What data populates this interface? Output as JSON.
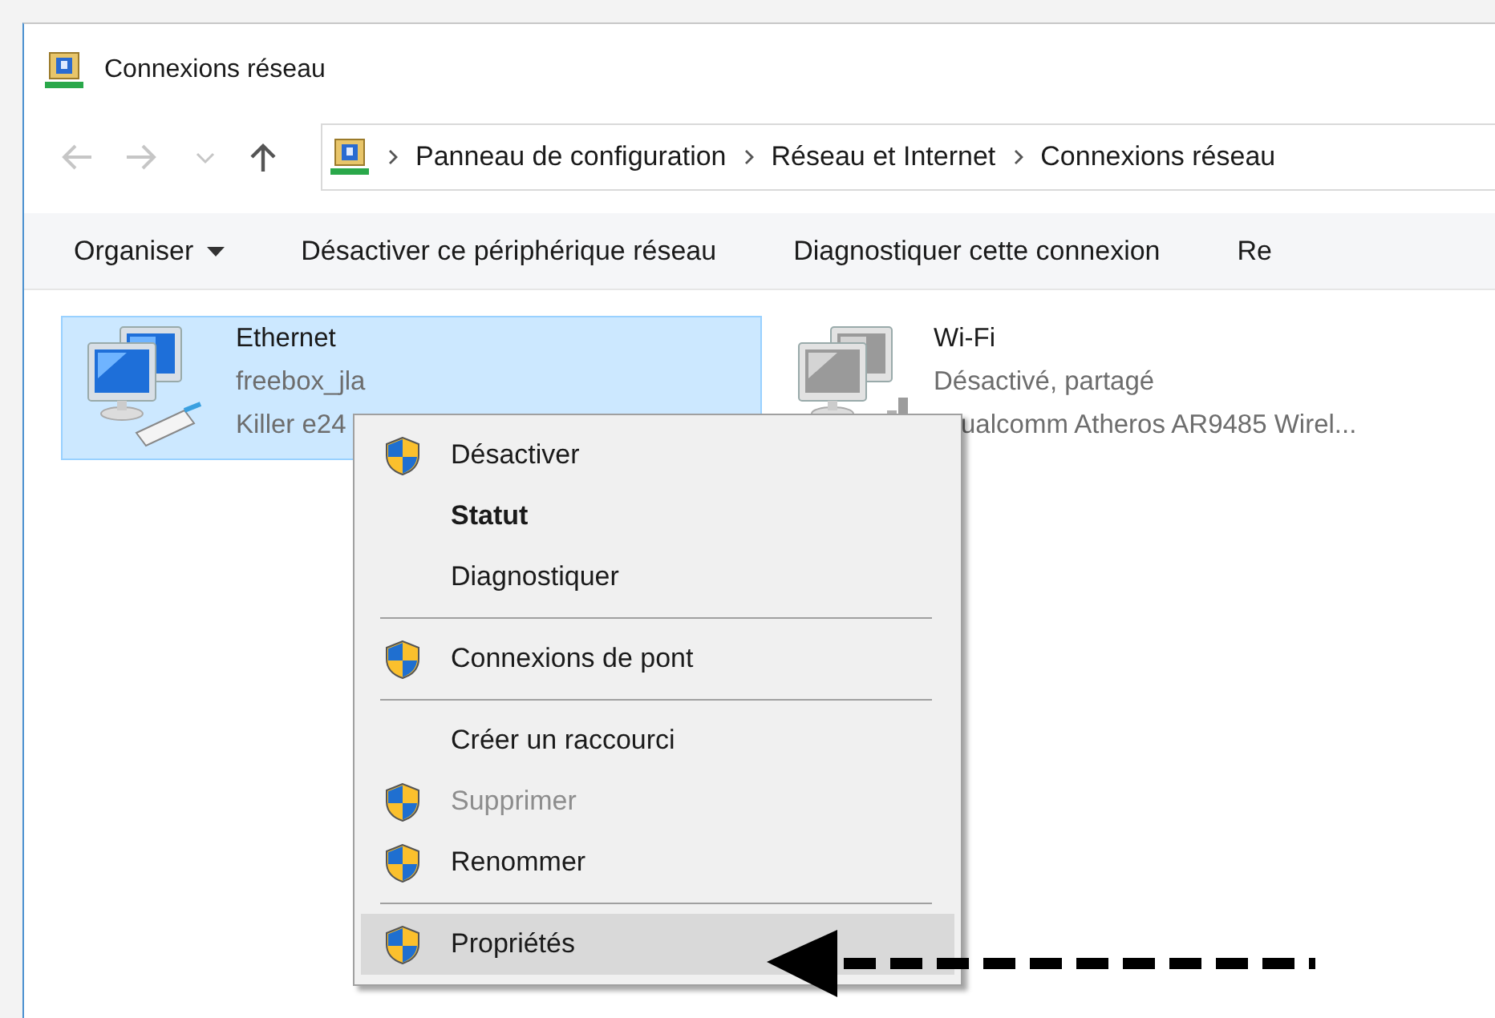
{
  "window": {
    "title": "Connexions réseau"
  },
  "nav_buttons": [
    {
      "kind": "back",
      "disabled": true
    },
    {
      "kind": "forward",
      "disabled": true
    },
    {
      "kind": "recent",
      "disabled": true
    },
    {
      "kind": "up",
      "disabled": false
    }
  ],
  "breadcrumb": [
    "Panneau de configuration",
    "Réseau et Internet",
    "Connexions réseau"
  ],
  "toolbar": [
    {
      "label": "Organiser",
      "dropdown": true
    },
    {
      "label": "Désactiver ce périphérique réseau",
      "dropdown": false
    },
    {
      "label": "Diagnostiquer cette connexion",
      "dropdown": false
    },
    {
      "label": "Re",
      "dropdown": false
    }
  ],
  "connections": [
    {
      "kind": "ethernet",
      "name": "Ethernet",
      "lines": [
        "freebox_jla",
        "Killer e24"
      ],
      "selected": true,
      "disabled": false
    },
    {
      "kind": "wifi",
      "name": "Wi-Fi",
      "lines": [
        "Désactivé, partagé",
        "ualcomm Atheros AR9485 Wirel..."
      ],
      "selected": false,
      "disabled": true
    }
  ],
  "context_menu": [
    {
      "kind": "item",
      "label": "Désactiver",
      "shield": true,
      "default": false,
      "disabled": false,
      "selected": false
    },
    {
      "kind": "item",
      "label": "Statut",
      "shield": false,
      "default": true,
      "disabled": false,
      "selected": false
    },
    {
      "kind": "item",
      "label": "Diagnostiquer",
      "shield": false,
      "default": false,
      "disabled": false,
      "selected": false
    },
    {
      "kind": "separator"
    },
    {
      "kind": "item",
      "label": "Connexions de pont",
      "shield": true,
      "default": false,
      "disabled": false,
      "selected": false
    },
    {
      "kind": "separator"
    },
    {
      "kind": "item",
      "label": "Créer un raccourci",
      "shield": false,
      "default": false,
      "disabled": false,
      "selected": false
    },
    {
      "kind": "item",
      "label": "Supprimer",
      "shield": true,
      "default": false,
      "disabled": true,
      "selected": false
    },
    {
      "kind": "item",
      "label": "Renommer",
      "shield": true,
      "default": false,
      "disabled": false,
      "selected": false
    },
    {
      "kind": "separator"
    },
    {
      "kind": "item",
      "label": "Propriétés",
      "shield": true,
      "default": false,
      "disabled": false,
      "selected": true
    }
  ]
}
